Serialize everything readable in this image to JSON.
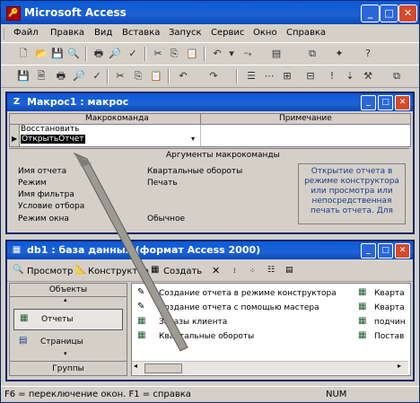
{
  "app": {
    "title": "Microsoft Access"
  },
  "menu": [
    "Файл",
    "Правка",
    "Вид",
    "Вставка",
    "Запуск",
    "Сервис",
    "Окно",
    "Справка"
  ],
  "macro_window": {
    "title": "Макрос1 : макрос",
    "col_action": "Макрокоманда",
    "col_note": "Примечание",
    "rows": [
      "Восстановить",
      "ОткрытьОтчет"
    ],
    "args_label": "Аргументы макрокоманды",
    "args": [
      {
        "name": "Имя отчета",
        "value": "Квартальные обороты"
      },
      {
        "name": "Режим",
        "value": "Печать"
      },
      {
        "name": "Имя фильтра",
        "value": ""
      },
      {
        "name": "Условие отбора",
        "value": ""
      },
      {
        "name": "Режим окна",
        "value": "Обычное"
      }
    ],
    "help": "Открытие отчета в режиме конструктора или просмотра или непосредственная печать отчета. Для"
  },
  "db_window": {
    "title": "db1 : база данных (формат Access 2000)",
    "toolbar": {
      "preview": "Просмотр",
      "design": "Конструктор",
      "create": "Создать"
    },
    "objects_header": "Объекты",
    "groups_label": "Группы",
    "nav": [
      "Отчеты",
      "Страницы"
    ],
    "list_left": [
      "Создание отчета в режиме конструктора",
      "Создание отчета с помощью мастера",
      "Заказы клиента",
      "Квартальные обороты"
    ],
    "list_right": [
      "Кварта",
      "Кварта",
      "подчин",
      "Постав"
    ]
  },
  "status": {
    "left": "F6 = переключение окон.  F1 = справка",
    "right": "NUM"
  }
}
